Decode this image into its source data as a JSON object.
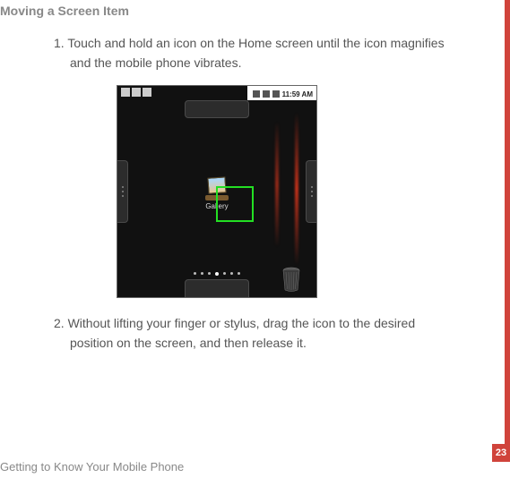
{
  "heading": "Moving a Screen Item",
  "steps": {
    "s1_num": "1.",
    "s1_text": "Touch and hold an icon on the Home screen until the icon magnifies and the mobile phone vibrates.",
    "s2_num": "2.",
    "s2_text": "Without lifting your finger or stylus, drag the icon to the desired position on the screen, and then release it."
  },
  "screenshot": {
    "clock": "11:59 AM",
    "app_label": "Gallery"
  },
  "footer": "Getting to Know Your Mobile Phone",
  "page_number": "23"
}
